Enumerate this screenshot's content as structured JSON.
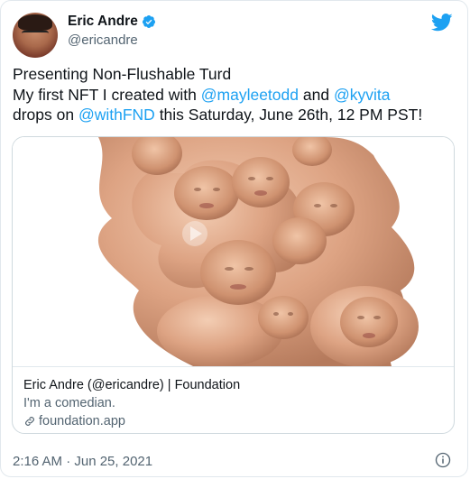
{
  "user": {
    "display_name": "Eric Andre",
    "handle": "@ericandre"
  },
  "tweet": {
    "line1": "Presenting Non-Flushable Turd",
    "line2_prefix": "My first NFT I created with ",
    "mention1": "@mayleetodd",
    "line2_mid": " and ",
    "mention2": "@kyvita",
    "line3_prefix": "drops on ",
    "mention3": "@withFND",
    "line3_suffix": " this Saturday, June 26th, 12 PM PST!"
  },
  "card": {
    "title": "Eric Andre (@ericandre) | Foundation",
    "description": "I'm a comedian.",
    "domain": "foundation.app"
  },
  "timestamp": "2:16 AM · Jun 25, 2021",
  "icons": {
    "verified": "verified-badge-icon",
    "bird": "twitter-bird-icon",
    "link": "link-icon",
    "info": "info-icon"
  },
  "colors": {
    "accent": "#1da1f2",
    "secondary_text": "#536471",
    "primary_text": "#0f1419",
    "skin": "#e8b496"
  }
}
